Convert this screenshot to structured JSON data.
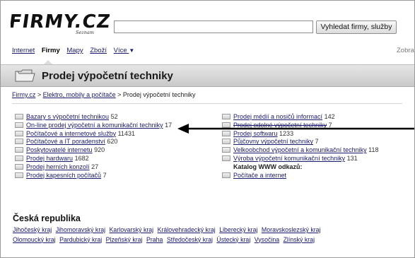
{
  "header": {
    "logo_alt": "Firmy.cz Seznam",
    "search_placeholder": "",
    "search_button_label": "Vyhledat firmy, služby"
  },
  "nav": {
    "items": [
      {
        "label": "Internet",
        "active": false
      },
      {
        "label": "Firmy",
        "active": true
      },
      {
        "label": "Mapy",
        "active": false
      },
      {
        "label": "Zboží",
        "active": false
      },
      {
        "label": "Více",
        "active": false
      }
    ],
    "right_text": "Zobra"
  },
  "page": {
    "title": "Prodej výpočetní techniky",
    "breadcrumb": [
      {
        "label": "Firmy.cz",
        "link": true
      },
      {
        "label": " > ",
        "link": false
      },
      {
        "label": "Elektro, mobily a počítače",
        "link": true
      },
      {
        "label": " > Prodej výpočetní techniky",
        "link": false
      }
    ]
  },
  "categories_left": [
    {
      "label": "Bazary s výpočetní technikou",
      "count": "52"
    },
    {
      "label": "On-line prodej výpočetní a komunikační techniky",
      "count": "17"
    },
    {
      "label": "Počítačové a internetové služby",
      "count": "11431"
    },
    {
      "label": "Počítačové a IT poradenství",
      "count": "620"
    },
    {
      "label": "Poskytovatelé internetu",
      "count": "920"
    },
    {
      "label": "Prodej hardwaru",
      "count": "1682"
    },
    {
      "label": "Prodej herních konzolí",
      "count": "27"
    },
    {
      "label": "Prodej kapesních počítačů",
      "count": "7"
    }
  ],
  "categories_right": [
    {
      "label": "Prodej médií a nosičů informací",
      "count": "142"
    },
    {
      "label": "Prodej odolné výpočetní techniky",
      "count": "7"
    },
    {
      "label": "Prodej softwaru",
      "count": "1233"
    },
    {
      "label": "Půjčovny výpočetní techniky",
      "count": "7"
    },
    {
      "label": "Velkoobchod výpočetní a komunikační techniky",
      "count": "118"
    },
    {
      "label": "Výroba výpočetní komunikační techniky",
      "count": "131"
    }
  ],
  "catalog": {
    "heading": "Katalog WWW odkazů:",
    "link": "Počítače a internet"
  },
  "regions": {
    "title": "Česká republika",
    "items": [
      "Jihočeský kraj",
      "Jihomoravský kraj",
      "Karlovarský kraj",
      "Královehradecký kraj",
      "Liberecký kraj",
      "Moravskoslezský kraj",
      "Olomoucký kraj",
      "Pardubický kraj",
      "Plzeňský kraj",
      "Praha",
      "Středočeský kraj",
      "Ústecký kraj",
      "Vysočina",
      "Zlínský kraj"
    ]
  }
}
